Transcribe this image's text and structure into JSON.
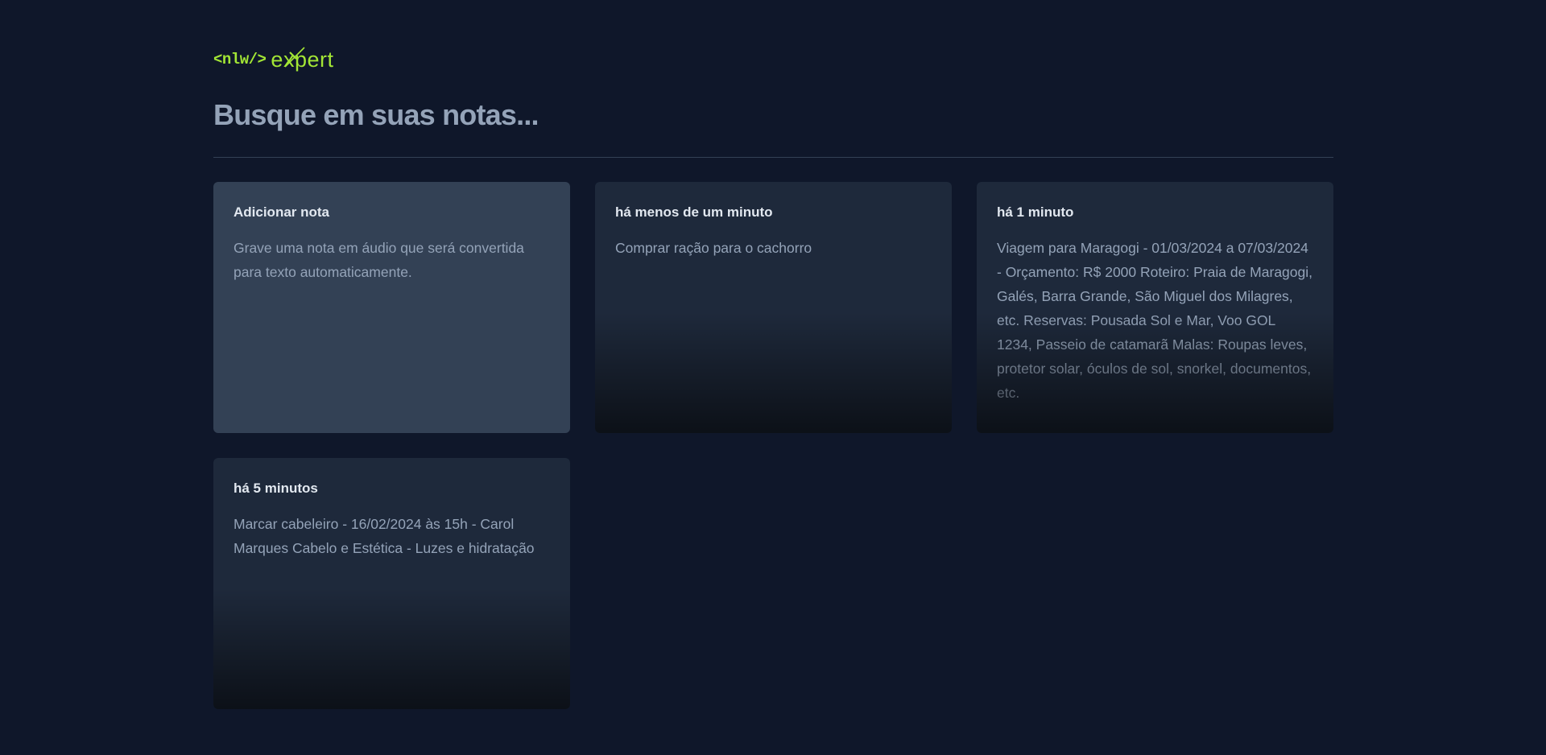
{
  "logo": {
    "code": "<nlw/>",
    "word": "expert",
    "accent_color": "#a3e635"
  },
  "search": {
    "placeholder": "Busque em suas notas...",
    "value": ""
  },
  "add_card": {
    "title": "Adicionar nota",
    "description": "Grave uma nota em áudio que será convertida para texto automaticamente."
  },
  "notes": [
    {
      "date": "há menos de um minuto",
      "content": "Comprar ração para o cachorro"
    },
    {
      "date": "há 1 minuto",
      "content": "Viagem para Maragogi - 01/03/2024 a 07/03/2024 - Orçamento: R$ 2000 Roteiro: Praia de Maragogi, Galés, Barra Grande, São Miguel dos Milagres, etc. Reservas: Pousada Sol e Mar, Voo GOL 1234, Passeio de catamarã Malas: Roupas leves, protetor solar, óculos de sol, snorkel, documentos, etc."
    },
    {
      "date": "há 5 minutos",
      "content": "Marcar cabeleiro - 16/02/2024 às 15h - Carol Marques Cabelo e Estética - Luzes e hidratação"
    }
  ]
}
